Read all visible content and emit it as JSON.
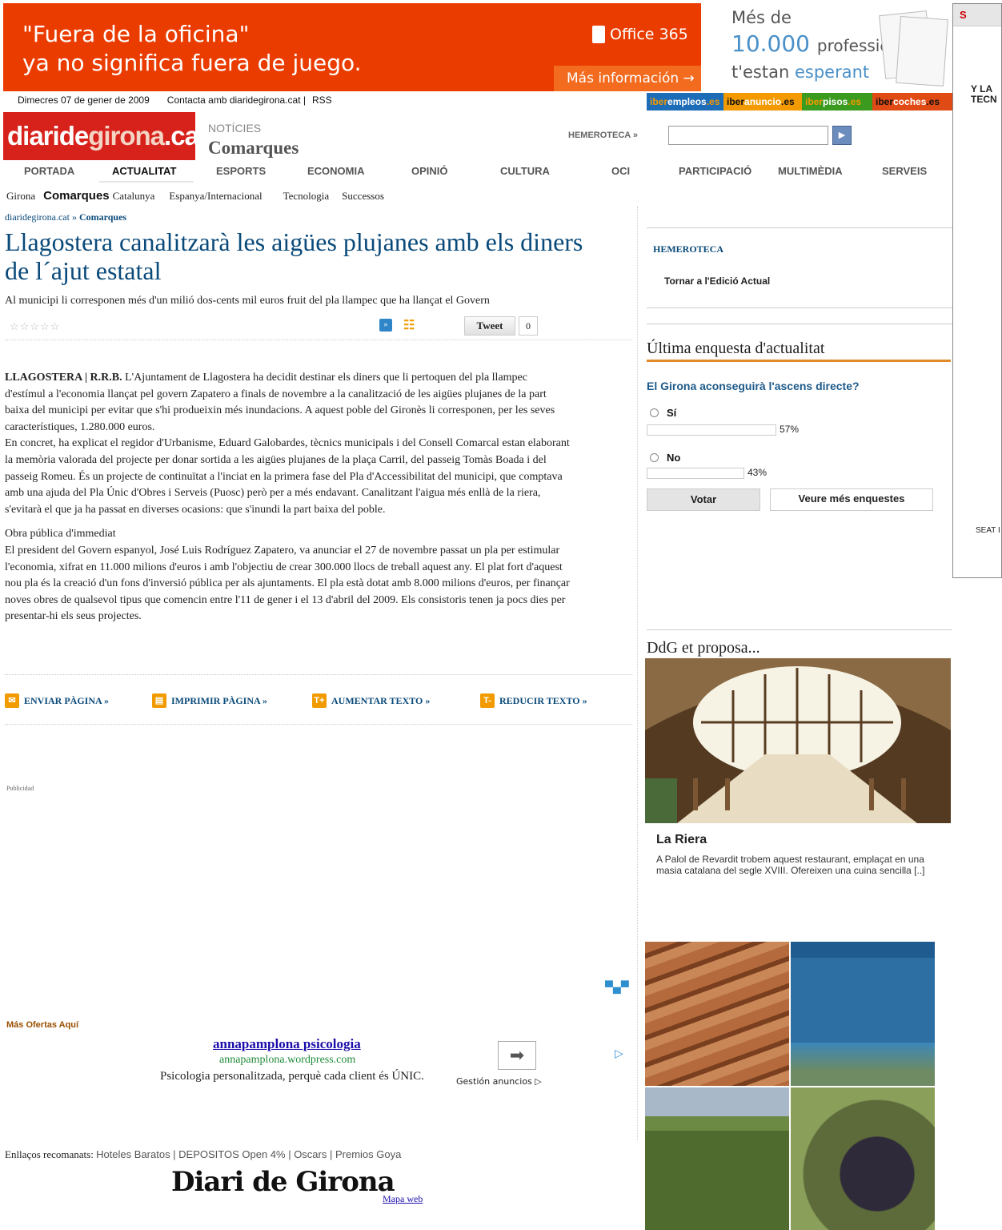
{
  "ads": {
    "top": {
      "line1": "\"Fuera de la oficina\"",
      "line2": "ya no significa fuera de juego.",
      "brand": "Office 365",
      "cta": "Más información →",
      "bg_color": "#eb3c00"
    },
    "right": {
      "line1": "Més de",
      "line2a": "10.000",
      "line2b": "professionals",
      "line3a": "t'estan",
      "line3b": "esperant"
    },
    "side": {
      "header": "S",
      "text1": "Y LA",
      "text2": "TECN",
      "bottom": "SEAT I"
    },
    "publicidad": "Publicidad"
  },
  "topbar": {
    "date": "Dimecres 07 de gener de 2009",
    "contact": "Contacta amb diaridegirona.cat  |",
    "rss": "RSS"
  },
  "sites": [
    {
      "a": "iber",
      "b": "empleos",
      "c": ".es",
      "bg": "#1d6cb8"
    },
    {
      "a": "iber",
      "b": "anuncio",
      "c": ".es",
      "bg": "#f39a00"
    },
    {
      "a": "iber",
      "b": "pisos",
      "c": ".es",
      "bg": "#3a9b1f"
    },
    {
      "a": "iber",
      "b": "coches",
      "c": ".es",
      "bg": "#e04a14"
    }
  ],
  "header": {
    "logo_a": "diaride",
    "logo_b": "girona",
    "logo_c": ".cat",
    "section_small": "NOTÍCIES",
    "section_big": "Comarques",
    "hemeroteca_link": "HEMEROTECA »"
  },
  "nav": [
    "PORTADA",
    "ACTUALITAT",
    "ESPORTS",
    "ECONOMIA",
    "OPINIÓ",
    "CULTURA",
    "OCI",
    "PARTICIPACIÓ",
    "MULTIMÈDIA",
    "SERVEIS"
  ],
  "subnav": [
    "Girona",
    "Comarques",
    "Catalunya",
    "Espanya/Internacional",
    "Tecnologia",
    "Successos"
  ],
  "article": {
    "breadcrumb_home": "diaridegirona.cat",
    "breadcrumb_sep": " » ",
    "breadcrumb_section": "Comarques",
    "title": "Llagostera canalitzarà les aigües plujanes amb els diners de l´ajut estatal",
    "subtitle": "Al municipi li corresponen més d'un milió dos-cents mil euros fruit del pla llampec que ha llançat el Govern",
    "stars": "☆☆☆☆☆",
    "tweet": "Tweet",
    "tweet_count": "0",
    "lead": "LLAGOSTERA | R.R.B.",
    "p1": " L'Ajuntament de Llagostera ha decidit destinar els diners que li pertoquen del pla llampec d'estímul a l'economia llançat pel govern Zapatero a finals de novembre a la canalització de les aigües plujanes de la part baixa del municipi per evitar que s'hi produeixin més inundacions. A aquest poble del Gironès li corresponen, per les seves característiques, 1.280.000 euros.",
    "p2": "En concret, ha explicat el regidor d'Urbanisme, Eduard Galobardes, tècnics municipals i del Consell Comarcal estan elaborant la memòria valorada del projecte per donar sortida a les aigües plujanes de la plaça Carril, del passeig Tomàs Boada i del passeig Romeu. És un projecte de continuïtat a l'inciat en la primera fase del Pla d'Accessibilitat del municipi, que comptava amb una ajuda del Pla Únic d'Obres i Serveis (Puosc) però per a més endavant. Canalitzant l'aigua més enllà de la riera, s'evitarà el que ja ha passat en diverses ocasions: que s'inundi la part baixa del poble.",
    "h2": "Obra pública d'immediat",
    "p3": "El president del Govern espanyol, José Luis Rodríguez Zapatero, va anunciar el 27 de novembre passat un pla per estimular l'economia, xifrat en 11.000 milions d'euros i amb l'objectiu de crear 300.000 llocs de treball aquest any. El plat fort d'aquest nou pla és la creació d'un fons d'inversió pública per als ajuntaments. El pla està dotat amb 8.000 milions d'euros, per finançar noves obres de qualsevol tipus que comencin entre l'11 de gener i el 13 d'abril del 2009. Els consistoris tenen ja pocs dies per presentar-hi els seus projectes."
  },
  "tools": {
    "send": "ENVIAR PÀGINA »",
    "print": "IMPRIMIR PÀGINA »",
    "bigger": "AUMENTAR TEXTO »",
    "smaller": "REDUCIR TEXTO »"
  },
  "google_ad": {
    "more": "Más Ofertas Aquí",
    "title": "annapamplona psicologia",
    "url": "annapamplona.wordpress.com",
    "desc": "Psicologia personalitzada, perquè cada client és ÚNIC.",
    "manage": "Gestión anuncios ▷"
  },
  "links": {
    "label": "Enllaços recomanats:",
    "items": "Hoteles Baratos | DEPOSITOS Open 4% | Oscars | Premios Goya"
  },
  "footer": {
    "logo": "Diari de Girona",
    "map": "Mapa web"
  },
  "sidebar": {
    "hemeroteca": "HEMEROTECA",
    "back": "Tornar a l'Edició Actual",
    "poll_heading": "Última enquesta d'actualitat",
    "poll_question": "El Girona aconseguirà l'ascens directe?",
    "options": [
      {
        "label": "Sí",
        "pct": "57%",
        "value": 0.57
      },
      {
        "label": "No",
        "pct": "43%",
        "value": 0.43
      }
    ],
    "vote": "Votar",
    "more": "Veure més enquestes",
    "ddg_heading": "DdG et proposa...",
    "ddg_title": "La Riera",
    "ddg_desc": "A Palol de Revardit trobem aquest restaurant, emplaçat en una masia catalana del segle XVIII. Ofereixen una cuina sencilla [..]"
  }
}
